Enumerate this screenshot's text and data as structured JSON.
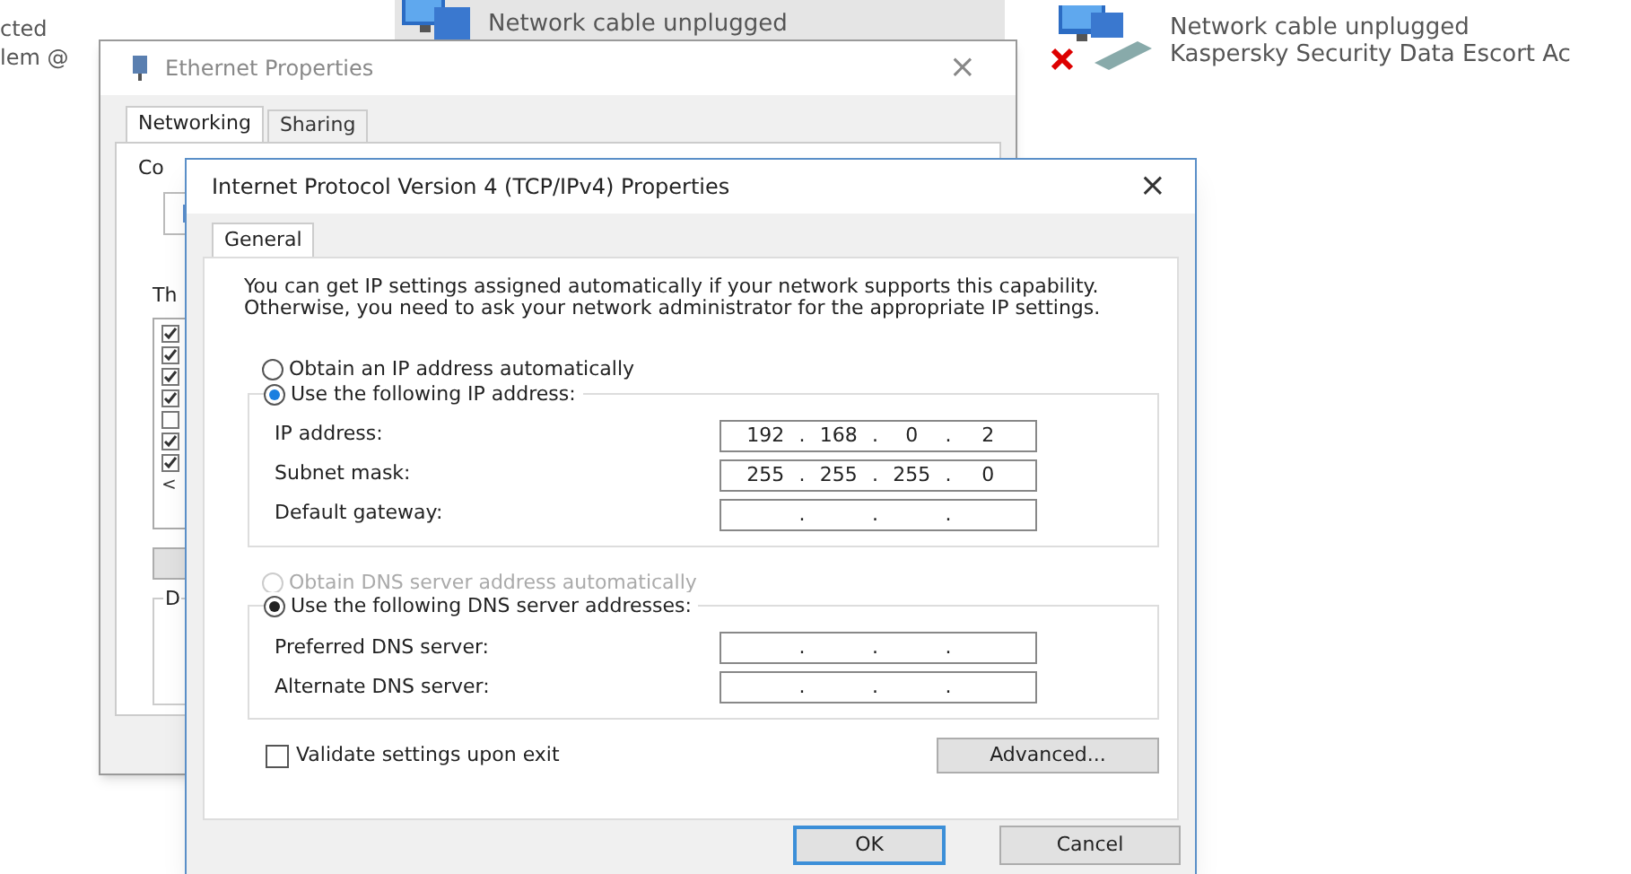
{
  "background": {
    "left_fragments": [
      "cted",
      "lem @"
    ],
    "connections": [
      {
        "status": "Network cable unplugged",
        "selected": true,
        "disconnected": false
      },
      {
        "status": "Network cable unplugged",
        "adapter": "Kaspersky Security Data Escort Ac",
        "selected": false,
        "disconnected": true
      }
    ]
  },
  "ethernet_window": {
    "title": "Ethernet Properties",
    "close": "×",
    "tabs": [
      {
        "label": "Networking",
        "selected": true
      },
      {
        "label": "Sharing",
        "selected": false
      }
    ],
    "connect_label": "Co",
    "items_label": "Th",
    "components": [
      {
        "checked": true
      },
      {
        "checked": true
      },
      {
        "checked": true
      },
      {
        "checked": true
      },
      {
        "checked": false
      },
      {
        "checked": true
      },
      {
        "checked": true
      }
    ],
    "scroll_left": "<",
    "group_label": "D"
  },
  "ipv4_dialog": {
    "title": "Internet Protocol Version 4 (TCP/IPv4) Properties",
    "close": "×",
    "tabs": [
      {
        "label": "General",
        "selected": true
      }
    ],
    "intro": "You can get IP settings assigned automatically if your network supports this capability. Otherwise, you need to ask your network administrator for the appropriate IP settings.",
    "ip_options": [
      {
        "label": "Obtain an IP address automatically",
        "selected": false,
        "disabled": false
      },
      {
        "label": "Use the following IP address:",
        "selected": true,
        "disabled": false
      }
    ],
    "ip_fields": [
      {
        "label": "IP address:",
        "segments": [
          {
            "octet": "192",
            "dot": "."
          },
          {
            "octet": "168",
            "dot": "."
          },
          {
            "octet": "0",
            "dot": "."
          },
          {
            "octet": "2"
          }
        ]
      },
      {
        "label": "Subnet mask:",
        "segments": [
          {
            "octet": "255",
            "dot": "."
          },
          {
            "octet": "255",
            "dot": "."
          },
          {
            "octet": "255",
            "dot": "."
          },
          {
            "octet": "0"
          }
        ]
      },
      {
        "label": "Default gateway:",
        "segments": [
          {
            "dot": "."
          },
          {
            "dot": "."
          },
          {
            "dot": "."
          }
        ]
      }
    ],
    "dns_options": [
      {
        "label": "Obtain DNS server address automatically",
        "selected": false,
        "disabled": true
      },
      {
        "label": "Use the following DNS server addresses:",
        "selected": true,
        "disabled": false
      }
    ],
    "dns_fields": [
      {
        "label": "Preferred DNS server:",
        "segments": [
          {
            "dot": "."
          },
          {
            "dot": "."
          },
          {
            "dot": "."
          }
        ]
      },
      {
        "label": "Alternate DNS server:",
        "segments": [
          {
            "dot": "."
          },
          {
            "dot": "."
          },
          {
            "dot": "."
          }
        ]
      }
    ],
    "validate": {
      "label": "Validate settings upon exit",
      "checked": false
    },
    "advanced_button": "Advanced...",
    "buttons": [
      {
        "label": "OK",
        "default": true
      },
      {
        "label": "Cancel",
        "default": false
      }
    ]
  }
}
